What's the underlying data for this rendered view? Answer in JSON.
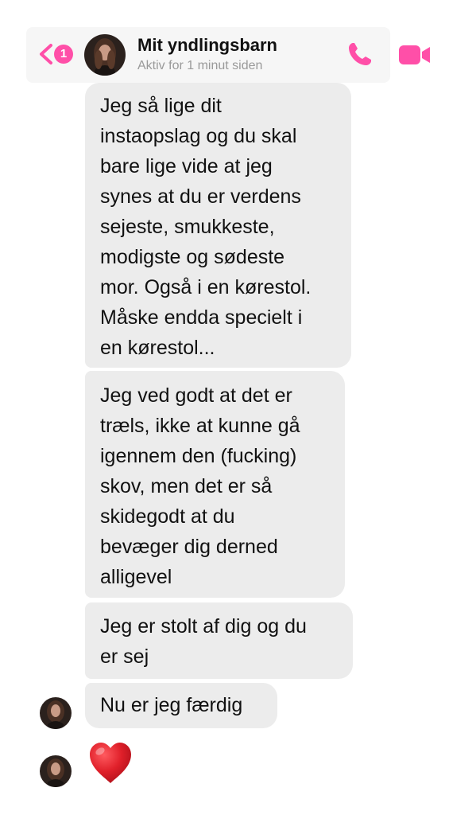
{
  "header": {
    "unread_count": "1",
    "contact_name": "Mit yndlingsbarn",
    "status": "Aktiv for 1 minut siden",
    "icons": {
      "back": "chevron-left-icon",
      "call": "phone-icon",
      "video": "video-camera-icon"
    },
    "accent_color": "#ff4fa8"
  },
  "messages": [
    {
      "text": "Jeg så lige dit\ninstaopslag og du skal\nbare lige vide at jeg\nsynes at du er verdens\nsejeste, smukkeste,\nmodigste og sødeste\nmor. Også i en kørestol.\nMåske endda specielt i\nen kørestol..."
    },
    {
      "text": "Jeg ved godt at det er\ntræls, ikke at kunne gå\nigennem den (fucking)\nskov, men det er så\nskidegodt at du\nbevæger dig derned\nalligevel"
    },
    {
      "text": "Jeg er stolt af dig og du\ner sej"
    },
    {
      "text": "Nu er jeg færdig"
    }
  ],
  "reaction": {
    "icon": "red-heart-icon",
    "color": "#e0202a"
  },
  "colors": {
    "bubble_background": "#ececec",
    "header_background": "#f6f6f6",
    "status_text": "#9a9a9a"
  }
}
